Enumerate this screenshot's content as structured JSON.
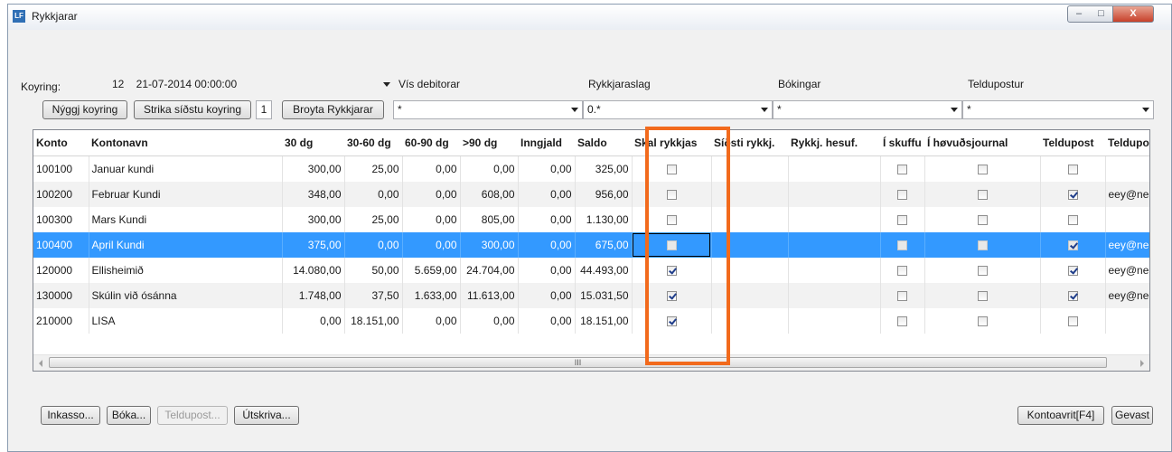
{
  "window": {
    "icon_label": "LF",
    "title": "Rykkjarar",
    "minimize": "–",
    "maximize": "□",
    "close": "X"
  },
  "toolbar": {
    "koyring_label": "Koyring:",
    "koyring_value": "12    21-07-2014 00:00:00",
    "new_run": "Nýggj koyring",
    "delete_last_run": "Strika síðstu koyring",
    "run_count": "1",
    "change_reminders": "Broyta Rykkjarar"
  },
  "filters": [
    {
      "label": "Vís debitorar",
      "value": "*"
    },
    {
      "label": "Rykkjaraslag",
      "value": "0.*"
    },
    {
      "label": "Bókingar",
      "value": "*"
    },
    {
      "label": "Teldupostur",
      "value": "*"
    }
  ],
  "table": {
    "columns": [
      "Konto",
      "Kontonavn",
      "30 dg",
      "30-60 dg",
      "60-90 dg",
      ">90 dg",
      "Inngjald",
      "Saldo",
      "Skal rykkjas",
      "Síðsti rykkj.",
      "Rykkj. hesuf.",
      "Í skuffu",
      "Í høvuðsjournal",
      "Teldupost",
      "Teldupos"
    ],
    "rows": [
      {
        "konto": "100100",
        "name": "Januar kundi",
        "d30": "300,00",
        "d60": "25,00",
        "d90": "0,00",
        "d90p": "0,00",
        "inn": "0,00",
        "saldo": "325,00",
        "skal": false,
        "sidsti": "",
        "hesuf": "",
        "skuffu": false,
        "journal": false,
        "teldupost": false,
        "email": ""
      },
      {
        "konto": "100200",
        "name": "Februar Kundi",
        "d30": "348,00",
        "d60": "0,00",
        "d90": "0,00",
        "d90p": "608,00",
        "inn": "0,00",
        "saldo": "956,00",
        "skal": false,
        "sidsti": "",
        "hesuf": "",
        "skuffu": false,
        "journal": false,
        "teldupost": true,
        "email": "eey@nem"
      },
      {
        "konto": "100300",
        "name": "Mars Kundi",
        "d30": "300,00",
        "d60": "25,00",
        "d90": "0,00",
        "d90p": "805,00",
        "inn": "0,00",
        "saldo": "1.130,00",
        "skal": false,
        "sidsti": "",
        "hesuf": "",
        "skuffu": false,
        "journal": false,
        "teldupost": false,
        "email": ""
      },
      {
        "konto": "100400",
        "name": "April Kundi",
        "d30": "375,00",
        "d60": "0,00",
        "d90": "0,00",
        "d90p": "300,00",
        "inn": "0,00",
        "saldo": "675,00",
        "skal": false,
        "sidsti": "",
        "hesuf": "",
        "skuffu": false,
        "journal": false,
        "teldupost": true,
        "email": "eey@nem"
      },
      {
        "konto": "120000",
        "name": "Ellisheimið",
        "d30": "14.080,00",
        "d60": "50,00",
        "d90": "5.659,00",
        "d90p": "24.704,00",
        "inn": "0,00",
        "saldo": "44.493,00",
        "skal": true,
        "sidsti": "",
        "hesuf": "",
        "skuffu": false,
        "journal": false,
        "teldupost": true,
        "email": "eey@nem"
      },
      {
        "konto": "130000",
        "name": "Skúlin við ósánna",
        "d30": "1.748,00",
        "d60": "37,50",
        "d90": "1.633,00",
        "d90p": "11.613,00",
        "inn": "0,00",
        "saldo": "15.031,50",
        "skal": true,
        "sidsti": "",
        "hesuf": "",
        "skuffu": false,
        "journal": false,
        "teldupost": true,
        "email": "eey@nem"
      },
      {
        "konto": "210000",
        "name": "LISA",
        "d30": "0,00",
        "d60": "18.151,00",
        "d90": "0,00",
        "d90p": "0,00",
        "inn": "0,00",
        "saldo": "18.151,00",
        "skal": true,
        "sidsti": "",
        "hesuf": "",
        "skuffu": false,
        "journal": false,
        "teldupost": false,
        "email": ""
      }
    ],
    "selected_row": 3
  },
  "scrollbar": {
    "grip": "III"
  },
  "footer": {
    "inkasso": "Inkasso...",
    "boka": "Bóka...",
    "teldupost": "Teldupost...",
    "utskriva": "Útskriva...",
    "kontoavrit": "Kontoavrit[F4]",
    "gevast": "Gevast"
  },
  "colors": {
    "selection": "#3399ff",
    "highlight_box": "#f26a1c",
    "title_accent": "#2f6fb5"
  },
  "icons": [
    "app-icon",
    "minimize-icon",
    "maximize-icon",
    "close-icon",
    "dropdown-arrow-icon",
    "checkbox-icon",
    "scroll-left-icon",
    "scroll-right-icon"
  ]
}
